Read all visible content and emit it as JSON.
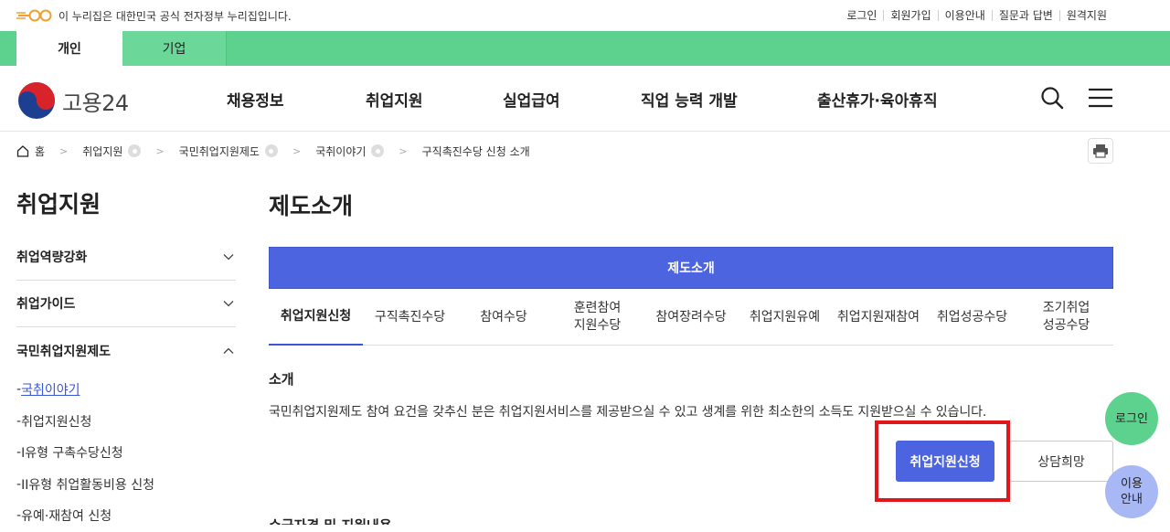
{
  "top_notice": {
    "text": "이 누리집은 대한민국 공식 전자정부 누리집입니다."
  },
  "util_links": [
    "로그인",
    "회원가입",
    "이용안내",
    "질문과 답변",
    "원격지원"
  ],
  "segments": {
    "personal": "개인",
    "company": "기업"
  },
  "logo": {
    "text": "고용24"
  },
  "menu": [
    "채용정보",
    "취업지원",
    "실업급여",
    "직업 능력 개발",
    "출산휴가·육아휴직"
  ],
  "breadcrumb": [
    "홈",
    "취업지원",
    "국민취업지원제도",
    "국취이야기",
    "구직촉진수당 신청 소개"
  ],
  "sidebar": {
    "title": "취업지원",
    "items": [
      "취업역량강화",
      "취업가이드",
      "국민취업지원제도"
    ],
    "subitems": [
      "국취이야기",
      "취업지원신청",
      "I유형 구촉수당신청",
      "II유형 취업활동비용 신청",
      "유예·재참여 신청"
    ]
  },
  "main": {
    "title": "제도소개",
    "blue_tab": "제도소개",
    "tabs": [
      "취업지원신청",
      "구직촉진수당",
      "참여수당",
      "훈련참여\n지원수당",
      "참여장려수당",
      "취업지원유예",
      "취업지원재참여",
      "취업성공수당",
      "조기취업\n성공수당"
    ],
    "section_heading": "소개",
    "description": "국민취업지원제도 참여 요건을 갖추신 분은 취업지원서비스를 제공받으실 수 있고 생계를 위한 최소한의 소득도 지원받으실 수 있습니다.",
    "apply_button": "취업지원신청",
    "consult_button": "상담희망",
    "next_heading": "수급자격 및 지원내용"
  },
  "floating": {
    "login": "로그인",
    "guide": "이용\n안내"
  },
  "colors": {
    "green": "#5dd28f",
    "blue": "#4c64e0",
    "highlight": "#e0161b"
  }
}
